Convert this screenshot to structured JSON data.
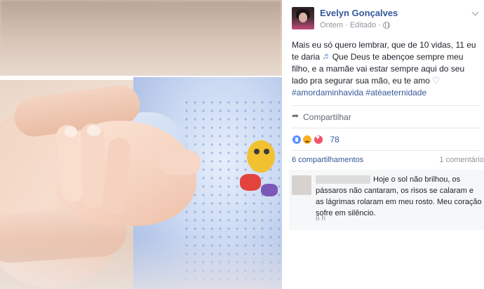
{
  "post": {
    "author": "Evelyn Gonçalves",
    "meta_time": "Ontem",
    "meta_sep": "·",
    "meta_edited": "Editado",
    "meta_sep2": "·",
    "text_part1": "Mais eu só quero lembrar, que de 10 vidas, 11 eu te daria ",
    "text_part2": " Que Deus te abençoe sempre meu filho, e a mamãe vai estar sempre aqui do seu lado pra segurar sua mão, eu te amo ",
    "hashtags": "#amordaminhavida #atéaeternidade",
    "share_label": "Compartilhar",
    "reaction_count": "78",
    "shares_label": "6 compartilhamentos",
    "comments_label": "1 comentário"
  },
  "comment": {
    "text": "Hoje o sol não brilhou, os pássaros não cantaram, os risos se calaram e as lágrimas rolaram em meu rosto. Meu coração sofre em silêncio.",
    "time": "6 h"
  },
  "icons": {
    "privacy": "globe-icon",
    "options": "chevron-down-icon",
    "music": "music-note-icon",
    "heart": "heart-icon",
    "share": "share-icon",
    "reactions": [
      "like-reaction-icon",
      "sad-reaction-icon",
      "love-reaction-icon"
    ]
  },
  "colors": {
    "link_blue": "#365899",
    "meta_gray": "#90949c",
    "like_blue": "#5890ff",
    "sad_yellow": "#f7b125",
    "love_red": "#f25268"
  }
}
